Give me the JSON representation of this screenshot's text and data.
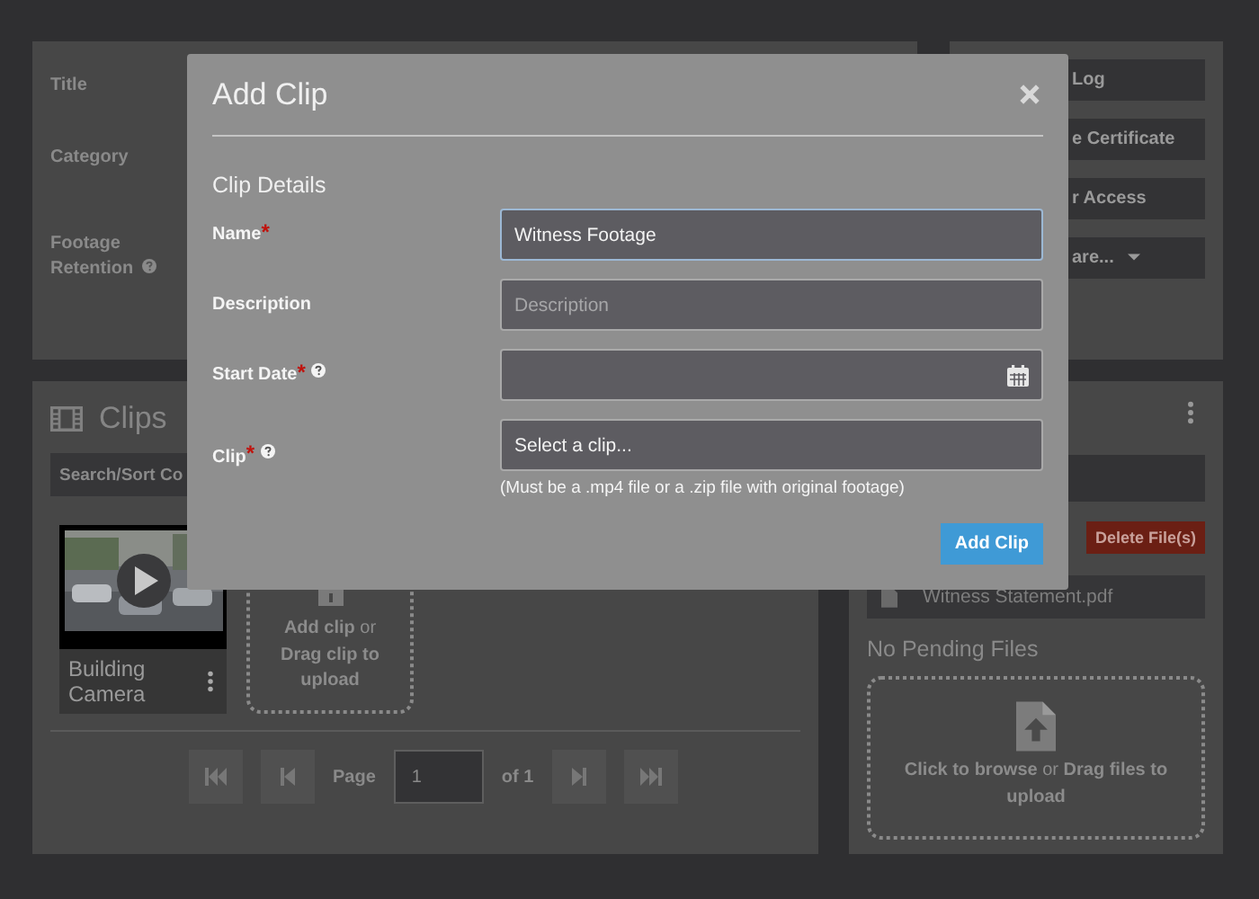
{
  "background": {
    "details_panel": {
      "labels": [
        {
          "text": "Title",
          "help": false
        },
        {
          "text": "Category",
          "help": false
        },
        {
          "text": "Footage Retention",
          "help": true
        }
      ]
    },
    "actions_panel": {
      "buttons": [
        {
          "label": "Log",
          "dropdown": false
        },
        {
          "label": "e Certificate",
          "dropdown": false
        },
        {
          "label": "r Access",
          "dropdown": false
        },
        {
          "label": "are...",
          "dropdown": true
        }
      ]
    },
    "clips_panel": {
      "title": "Clips",
      "search": {
        "placeholder": "Search/Sort Co"
      },
      "clips": [
        {
          "title": "Building Camera"
        }
      ],
      "upload": "**Add clip** or **Drag clip to upload**",
      "pagination": {
        "label": "Page",
        "page": "1",
        "total": "of 1"
      }
    },
    "files_panel": {
      "delete_button": "Delete File(s)",
      "files": [
        {
          "name": "Witness Statement.pdf"
        }
      ],
      "pending": "No Pending Files",
      "upload": "**Click to browse** or **Drag files to upload**"
    }
  },
  "modal": {
    "title": "Add Clip",
    "section": "Clip Details",
    "fields": [
      {
        "kind": "text",
        "label": "Name",
        "required": "*",
        "help": false,
        "value": "Witness Footage",
        "focused": true
      },
      {
        "kind": "text",
        "label": "Description",
        "help": false,
        "placeholder": "Description",
        "focused": false
      },
      {
        "kind": "date",
        "label": "Start Date",
        "required": "*",
        "help": true,
        "focused": false
      },
      {
        "kind": "file",
        "label": "Clip",
        "required": "*",
        "help": true,
        "value": "Select a clip...",
        "hint": "(Must be a .mp4 file or a .zip file with original footage)",
        "focused": false
      }
    ],
    "submit": "Add Clip"
  }
}
